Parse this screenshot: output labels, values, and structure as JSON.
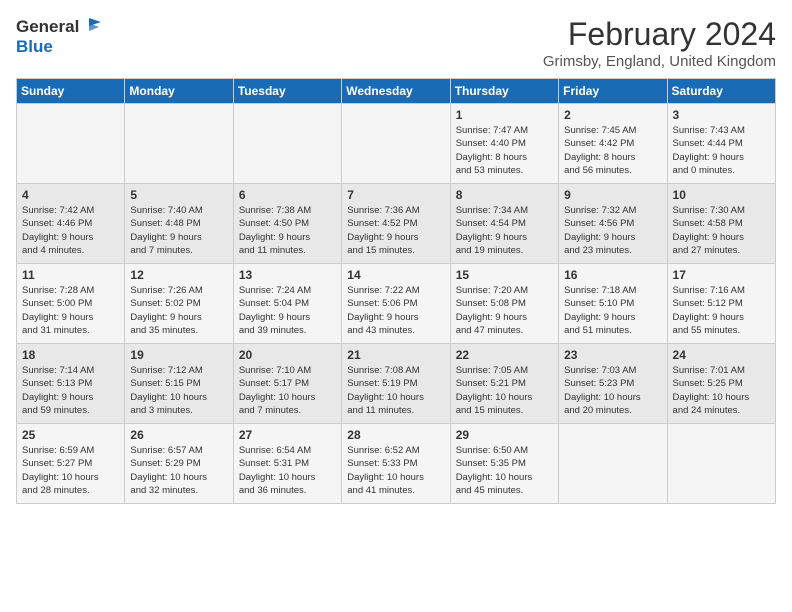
{
  "logo": {
    "line1": "General",
    "line2": "Blue"
  },
  "title": "February 2024",
  "location": "Grimsby, England, United Kingdom",
  "days_header": [
    "Sunday",
    "Monday",
    "Tuesday",
    "Wednesday",
    "Thursday",
    "Friday",
    "Saturday"
  ],
  "weeks": [
    [
      {
        "day": "",
        "info": ""
      },
      {
        "day": "",
        "info": ""
      },
      {
        "day": "",
        "info": ""
      },
      {
        "day": "",
        "info": ""
      },
      {
        "day": "1",
        "info": "Sunrise: 7:47 AM\nSunset: 4:40 PM\nDaylight: 8 hours\nand 53 minutes."
      },
      {
        "day": "2",
        "info": "Sunrise: 7:45 AM\nSunset: 4:42 PM\nDaylight: 8 hours\nand 56 minutes."
      },
      {
        "day": "3",
        "info": "Sunrise: 7:43 AM\nSunset: 4:44 PM\nDaylight: 9 hours\nand 0 minutes."
      }
    ],
    [
      {
        "day": "4",
        "info": "Sunrise: 7:42 AM\nSunset: 4:46 PM\nDaylight: 9 hours\nand 4 minutes."
      },
      {
        "day": "5",
        "info": "Sunrise: 7:40 AM\nSunset: 4:48 PM\nDaylight: 9 hours\nand 7 minutes."
      },
      {
        "day": "6",
        "info": "Sunrise: 7:38 AM\nSunset: 4:50 PM\nDaylight: 9 hours\nand 11 minutes."
      },
      {
        "day": "7",
        "info": "Sunrise: 7:36 AM\nSunset: 4:52 PM\nDaylight: 9 hours\nand 15 minutes."
      },
      {
        "day": "8",
        "info": "Sunrise: 7:34 AM\nSunset: 4:54 PM\nDaylight: 9 hours\nand 19 minutes."
      },
      {
        "day": "9",
        "info": "Sunrise: 7:32 AM\nSunset: 4:56 PM\nDaylight: 9 hours\nand 23 minutes."
      },
      {
        "day": "10",
        "info": "Sunrise: 7:30 AM\nSunset: 4:58 PM\nDaylight: 9 hours\nand 27 minutes."
      }
    ],
    [
      {
        "day": "11",
        "info": "Sunrise: 7:28 AM\nSunset: 5:00 PM\nDaylight: 9 hours\nand 31 minutes."
      },
      {
        "day": "12",
        "info": "Sunrise: 7:26 AM\nSunset: 5:02 PM\nDaylight: 9 hours\nand 35 minutes."
      },
      {
        "day": "13",
        "info": "Sunrise: 7:24 AM\nSunset: 5:04 PM\nDaylight: 9 hours\nand 39 minutes."
      },
      {
        "day": "14",
        "info": "Sunrise: 7:22 AM\nSunset: 5:06 PM\nDaylight: 9 hours\nand 43 minutes."
      },
      {
        "day": "15",
        "info": "Sunrise: 7:20 AM\nSunset: 5:08 PM\nDaylight: 9 hours\nand 47 minutes."
      },
      {
        "day": "16",
        "info": "Sunrise: 7:18 AM\nSunset: 5:10 PM\nDaylight: 9 hours\nand 51 minutes."
      },
      {
        "day": "17",
        "info": "Sunrise: 7:16 AM\nSunset: 5:12 PM\nDaylight: 9 hours\nand 55 minutes."
      }
    ],
    [
      {
        "day": "18",
        "info": "Sunrise: 7:14 AM\nSunset: 5:13 PM\nDaylight: 9 hours\nand 59 minutes."
      },
      {
        "day": "19",
        "info": "Sunrise: 7:12 AM\nSunset: 5:15 PM\nDaylight: 10 hours\nand 3 minutes."
      },
      {
        "day": "20",
        "info": "Sunrise: 7:10 AM\nSunset: 5:17 PM\nDaylight: 10 hours\nand 7 minutes."
      },
      {
        "day": "21",
        "info": "Sunrise: 7:08 AM\nSunset: 5:19 PM\nDaylight: 10 hours\nand 11 minutes."
      },
      {
        "day": "22",
        "info": "Sunrise: 7:05 AM\nSunset: 5:21 PM\nDaylight: 10 hours\nand 15 minutes."
      },
      {
        "day": "23",
        "info": "Sunrise: 7:03 AM\nSunset: 5:23 PM\nDaylight: 10 hours\nand 20 minutes."
      },
      {
        "day": "24",
        "info": "Sunrise: 7:01 AM\nSunset: 5:25 PM\nDaylight: 10 hours\nand 24 minutes."
      }
    ],
    [
      {
        "day": "25",
        "info": "Sunrise: 6:59 AM\nSunset: 5:27 PM\nDaylight: 10 hours\nand 28 minutes."
      },
      {
        "day": "26",
        "info": "Sunrise: 6:57 AM\nSunset: 5:29 PM\nDaylight: 10 hours\nand 32 minutes."
      },
      {
        "day": "27",
        "info": "Sunrise: 6:54 AM\nSunset: 5:31 PM\nDaylight: 10 hours\nand 36 minutes."
      },
      {
        "day": "28",
        "info": "Sunrise: 6:52 AM\nSunset: 5:33 PM\nDaylight: 10 hours\nand 41 minutes."
      },
      {
        "day": "29",
        "info": "Sunrise: 6:50 AM\nSunset: 5:35 PM\nDaylight: 10 hours\nand 45 minutes."
      },
      {
        "day": "",
        "info": ""
      },
      {
        "day": "",
        "info": ""
      }
    ]
  ]
}
